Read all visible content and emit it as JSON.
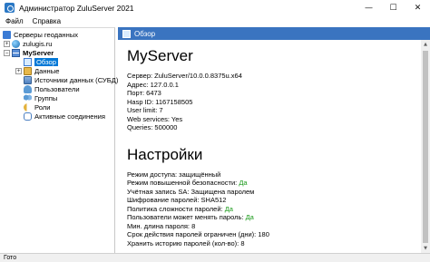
{
  "window": {
    "title": "Администратор ZuluServer 2021",
    "minimize_glyph": "—",
    "maximize_glyph": "☐",
    "close_glyph": "✕"
  },
  "menu": {
    "items": [
      {
        "label": "Файл"
      },
      {
        "label": "Справка"
      }
    ]
  },
  "tree": {
    "root": {
      "label": "Серверы геоданных",
      "icon": "servers-icon"
    },
    "nodes": [
      {
        "label": "zulugis.ru",
        "icon": "globe-icon",
        "expander": "+"
      },
      {
        "label": "MyServer",
        "icon": "server-icon",
        "expander": "−"
      },
      {
        "label": "Обзор",
        "icon": "overview-icon",
        "selected": true
      },
      {
        "label": "Данные",
        "icon": "folder-icon",
        "expander": "+"
      },
      {
        "label": "Источники данных (СУБД)",
        "icon": "database-icon"
      },
      {
        "label": "Пользователи",
        "icon": "user-icon"
      },
      {
        "label": "Группы",
        "icon": "group-icon"
      },
      {
        "label": "Роли",
        "icon": "key-icon"
      },
      {
        "label": "Активные соединения",
        "icon": "connection-icon"
      }
    ]
  },
  "content": {
    "header_title": "Обзор",
    "server_name": "MyServer",
    "info": [
      "Сервер: ZuluServer/10.0.0.8375u.x64",
      "Адрес: 127.0.0.1",
      "Порт: 6473",
      "Hasp ID: 1167158505",
      "User limit: 7",
      "Web services: Yes",
      "Queries: 500000"
    ],
    "settings_title": "Настройки",
    "settings": [
      {
        "label": "Режим доступа: защищённый",
        "value": ""
      },
      {
        "label": "Режим повышенной безопасности: ",
        "value": "Да"
      },
      {
        "label": "Учётная запись SA: Защищена паролем",
        "value": ""
      },
      {
        "label": "Шифрование паролей: SHA512",
        "value": ""
      },
      {
        "label": "Политика сложности паролей: ",
        "value": "Да"
      },
      {
        "label": "Пользователи может менять пароль: ",
        "value": "Да"
      },
      {
        "label": "Мин. длина пароля: 8",
        "value": ""
      },
      {
        "label": "Срок действия паролей ограничен (дни): 180",
        "value": ""
      },
      {
        "label": "Хранить историю паролей (кол-во): 8",
        "value": ""
      }
    ],
    "value_color": "#1a9a1a"
  },
  "status": {
    "text": "Гото"
  },
  "colors": {
    "header_bg": "#3a74c0",
    "selection": "#0078d7"
  }
}
